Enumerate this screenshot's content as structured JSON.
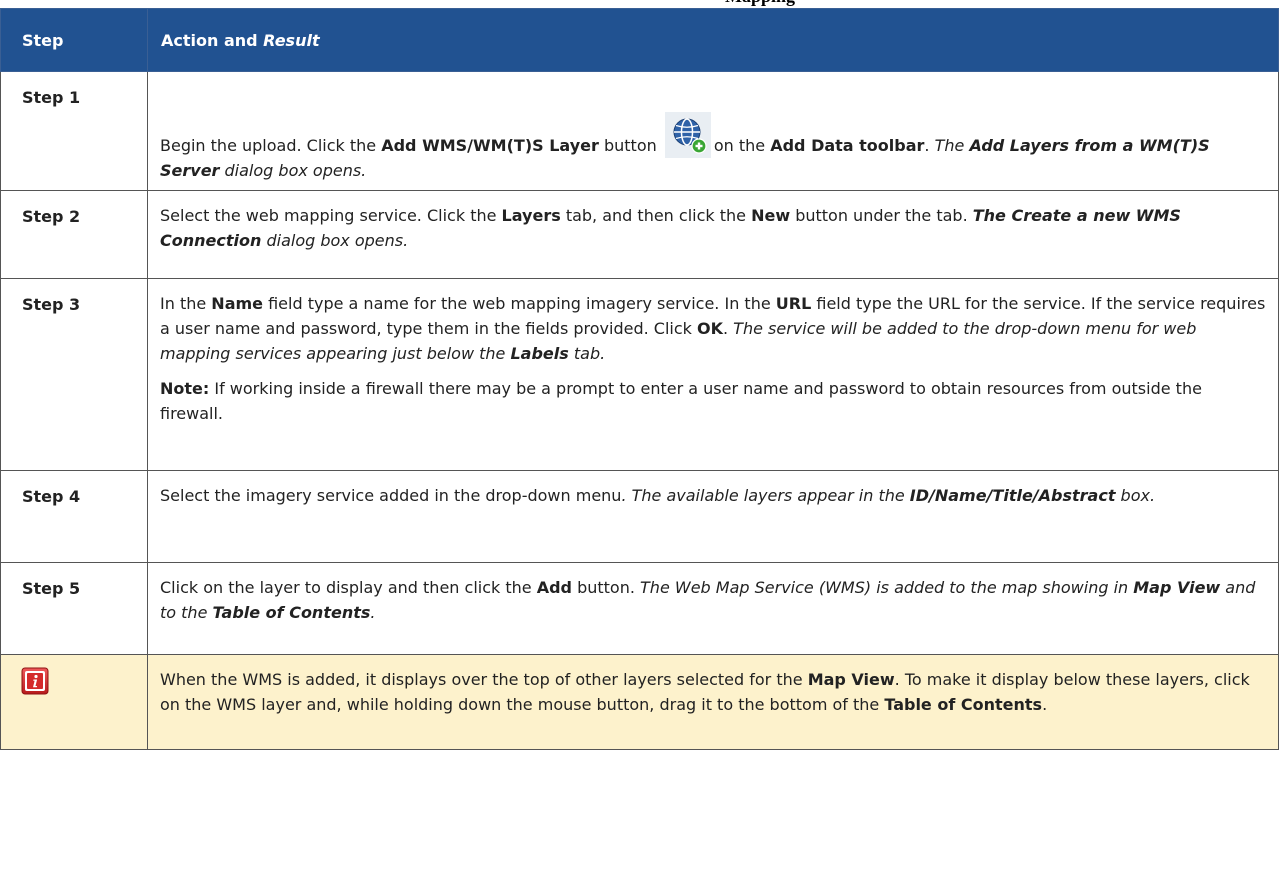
{
  "caption": "Mapping",
  "headers": {
    "step": "Step",
    "action_prefix": "Action and ",
    "action_suffix": "Result"
  },
  "rows": [
    {
      "step": "Step 1",
      "p1": [
        {
          "t": "Begin the upload. Click the ",
          "s": ""
        },
        {
          "t": "Add WMS/WM(T)S Layer",
          "s": "b"
        },
        {
          "t": " button ",
          "s": ""
        },
        {
          "icon": "add-wms-layer-icon"
        },
        {
          "t": "on the ",
          "s": ""
        },
        {
          "t": "Add Data toolbar",
          "s": "b"
        },
        {
          "t": ". ",
          "s": ""
        },
        {
          "t": "The ",
          "s": "i"
        },
        {
          "t": "Add Layers from a WM(T)S Server",
          "s": "bi"
        },
        {
          "t": " dialog box opens.",
          "s": "i"
        }
      ]
    },
    {
      "step": "Step 2",
      "p1": [
        {
          "t": "Select the web mapping service. Click the ",
          "s": ""
        },
        {
          "t": "Layers",
          "s": "b"
        },
        {
          "t": " tab, and then click the ",
          "s": ""
        },
        {
          "t": "New",
          "s": "b"
        },
        {
          "t": " button under the tab. ",
          "s": ""
        },
        {
          "t": "The Create a new WMS Connection",
          "s": "bi"
        },
        {
          "t": " dialog box opens.",
          "s": "i"
        }
      ]
    },
    {
      "step": "Step 3",
      "p1": [
        {
          "t": "In the ",
          "s": ""
        },
        {
          "t": "Name",
          "s": "b"
        },
        {
          "t": " field type a name for the web mapping imagery service. In the ",
          "s": ""
        },
        {
          "t": "URL",
          "s": "b"
        },
        {
          "t": " field type the URL for the service. If the service requires a user name and password, type them in the fields provided. Click ",
          "s": ""
        },
        {
          "t": "OK",
          "s": "b"
        },
        {
          "t": ". ",
          "s": ""
        },
        {
          "t": "The service will be added to the drop-down menu for web mapping services appearing just below the ",
          "s": "i"
        },
        {
          "t": "Labels",
          "s": "bi"
        },
        {
          "t": " tab.",
          "s": "i"
        }
      ],
      "p2": [
        {
          "t": "Note:",
          "s": "b"
        },
        {
          "t": "  If working inside a firewall there may be a prompt to enter a user name and password to obtain resources from outside the firewall.",
          "s": ""
        }
      ]
    },
    {
      "step": "Step 4",
      "p1": [
        {
          "t": "Select the imagery service added in the drop-down menu",
          "s": ""
        },
        {
          "t": ". The available layers appear in the ",
          "s": "i"
        },
        {
          "t": "ID/Name/Title/Abstract",
          "s": "bi"
        },
        {
          "t": " box.",
          "s": "i"
        }
      ]
    },
    {
      "step": "Step 5",
      "p1": [
        {
          "t": "Click on the layer to display and then click the ",
          "s": ""
        },
        {
          "t": "Add",
          "s": "b"
        },
        {
          "t": " button. ",
          "s": ""
        },
        {
          "t": "The Web Map Service (WMS) is added to the map showing in ",
          "s": "i"
        },
        {
          "t": "Map View",
          "s": "bi"
        },
        {
          "t": " and to the ",
          "s": "i"
        },
        {
          "t": "Table of Contents",
          "s": "bi"
        },
        {
          "t": ".",
          "s": "i"
        }
      ]
    }
  ],
  "note": {
    "icon": "info-icon",
    "p1": [
      {
        "t": "When the WMS is added, it displays over the top of other layers selected for the ",
        "s": ""
      },
      {
        "t": "Map View",
        "s": "b"
      },
      {
        "t": ". To make it display below these layers, click on the WMS layer and, while holding down the mouse button, drag it to the bottom of the ",
        "s": ""
      },
      {
        "t": "Table of Contents",
        "s": "b"
      },
      {
        "t": ".",
        "s": ""
      }
    ]
  },
  "colors": {
    "header_bg": "#215291",
    "note_bg": "#fdf2cc",
    "info_icon_red": "#d42a2a"
  }
}
